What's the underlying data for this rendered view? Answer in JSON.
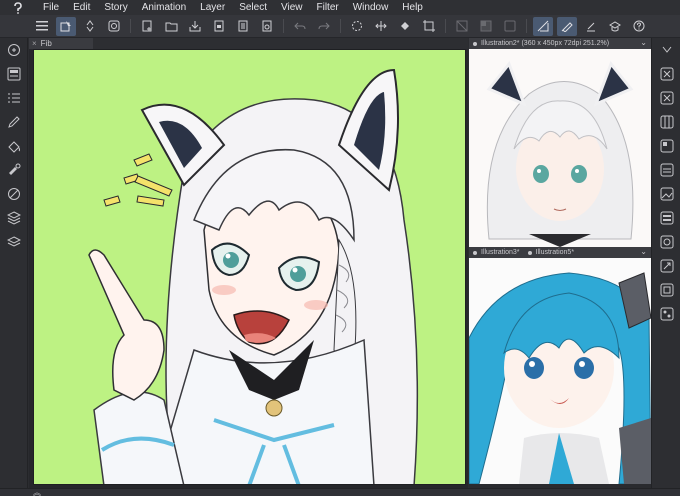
{
  "menubar": {
    "items": [
      "File",
      "Edit",
      "Story",
      "Animation",
      "Layer",
      "Select",
      "View",
      "Filter",
      "Window",
      "Help"
    ]
  },
  "document": {
    "tab_name": "Fib",
    "close_glyph": "×"
  },
  "subviews": [
    {
      "title": "Illustration2* (360 x 450px 72dpi 251.2%)"
    },
    {
      "title": "Illustration3*",
      "title2": "Illustration5*"
    }
  ],
  "colors": {
    "canvas_bg": "#bdf283",
    "accent": "#4a5a72",
    "ui_bg": "#2b2c30"
  },
  "icons": {
    "toolbar": [
      "menu-icon",
      "select-icon",
      "updown-icon",
      "layer-icon",
      "new-icon",
      "open-icon",
      "save-icon",
      "export-icon",
      "print-icon",
      "share-icon",
      "undo-icon",
      "redo-icon",
      "loading-icon",
      "transform-icon",
      "fill-icon",
      "crop-icon",
      "deselect-icon",
      "invert-icon",
      "snap-icon",
      "ruler-icon",
      "pen-icon",
      "grad-icon",
      "help-icon"
    ]
  }
}
